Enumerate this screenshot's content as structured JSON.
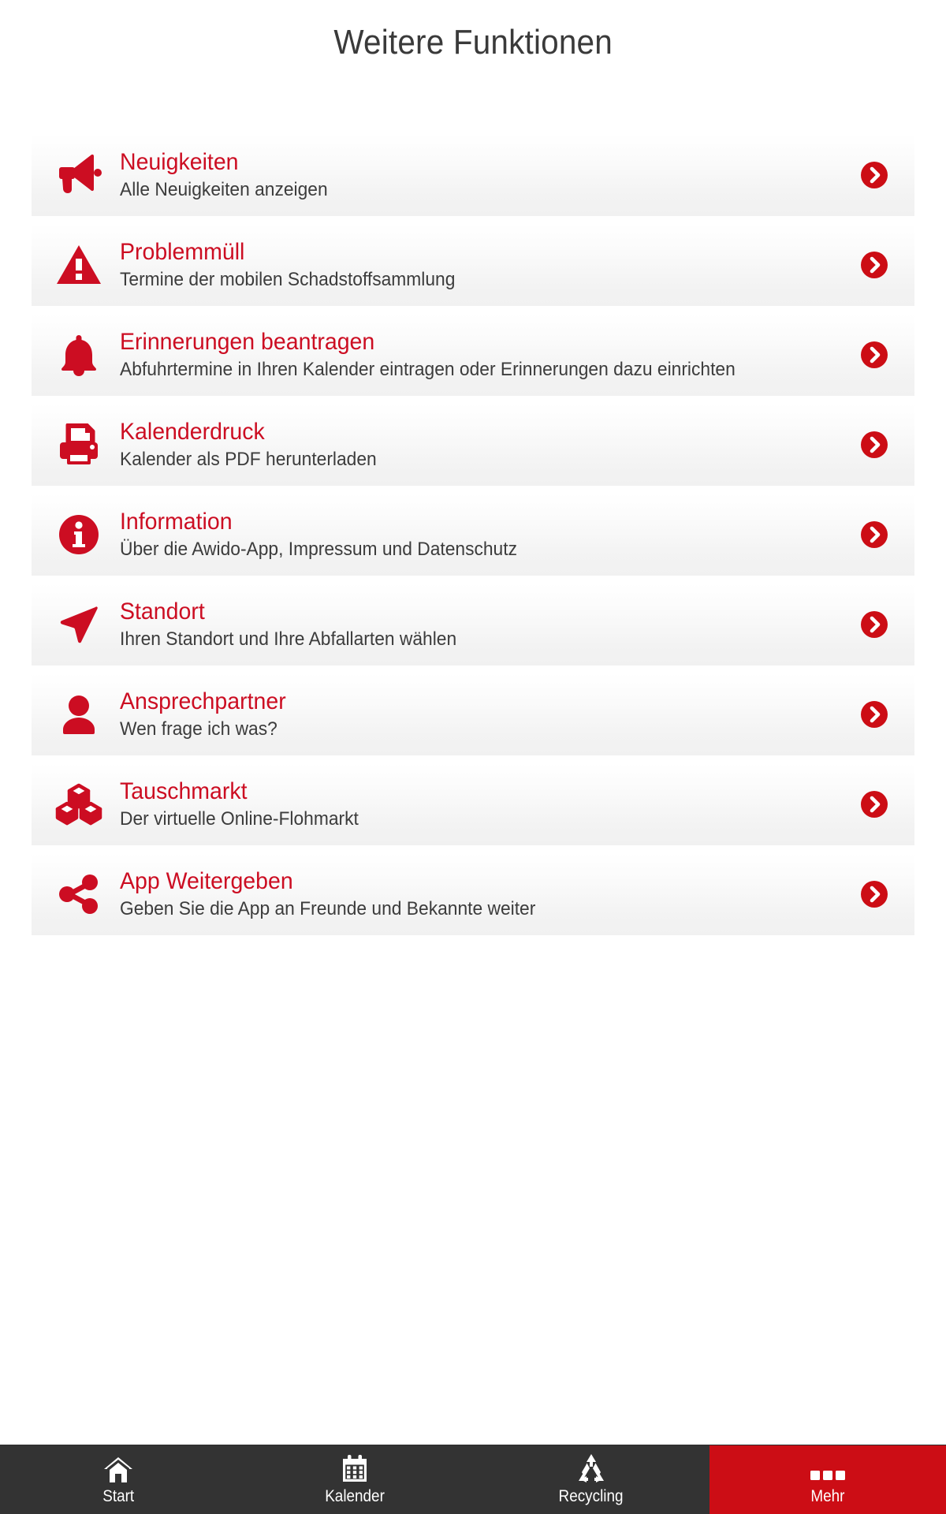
{
  "header": {
    "title": "Weitere Funktionen"
  },
  "colors": {
    "accent_red": "#cc0d22",
    "nav_active_red": "#cc0d15",
    "nav_background": "#333333",
    "row_background": "#f3f3f3",
    "title_text": "#3a3a3a",
    "subtitle_text": "#3c3c3c"
  },
  "list": {
    "items": [
      {
        "icon": "megaphone-icon",
        "title": "Neuigkeiten",
        "subtitle": "Alle Neuigkeiten anzeigen",
        "chevron": "chevron-right-circle-icon"
      },
      {
        "icon": "warning-triangle-icon",
        "title": "Problemmüll",
        "subtitle": "Termine der mobilen Schadstoffsammlung",
        "chevron": "chevron-right-circle-icon"
      },
      {
        "icon": "bell-icon",
        "title": "Erinnerungen beantragen",
        "subtitle": "Abfuhrtermine in Ihren Kalender eintragen oder Erinnerungen dazu einrichten",
        "chevron": "chevron-right-circle-icon"
      },
      {
        "icon": "printer-icon",
        "title": "Kalenderdruck",
        "subtitle": "Kalender als PDF herunterladen",
        "chevron": "chevron-right-circle-icon"
      },
      {
        "icon": "info-circle-icon",
        "title": "Information",
        "subtitle": "Über die Awido-App, Impressum und Datenschutz",
        "chevron": "chevron-right-circle-icon"
      },
      {
        "icon": "navigation-arrow-icon",
        "title": "Standort",
        "subtitle": "Ihren Standort und Ihre Abfallarten wählen",
        "chevron": "chevron-right-circle-icon"
      },
      {
        "icon": "person-icon",
        "title": "Ansprechpartner",
        "subtitle": "Wen frage ich was?",
        "chevron": "chevron-right-circle-icon"
      },
      {
        "icon": "boxes-icon",
        "title": "Tauschmarkt",
        "subtitle": "Der virtuelle Online-Flohmarkt",
        "chevron": "chevron-right-circle-icon"
      },
      {
        "icon": "share-icon",
        "title": "App Weitergeben",
        "subtitle": "Geben Sie die App an Freunde und Bekannte weiter",
        "chevron": "chevron-right-circle-icon"
      }
    ]
  },
  "bottom_nav": {
    "items": [
      {
        "icon": "home-icon",
        "label": "Start",
        "active": false
      },
      {
        "icon": "calendar-icon",
        "label": "Kalender",
        "active": false
      },
      {
        "icon": "recycling-icon",
        "label": "Recycling",
        "active": false
      },
      {
        "icon": "ellipsis-icon",
        "label": "Mehr",
        "active": true
      }
    ]
  }
}
